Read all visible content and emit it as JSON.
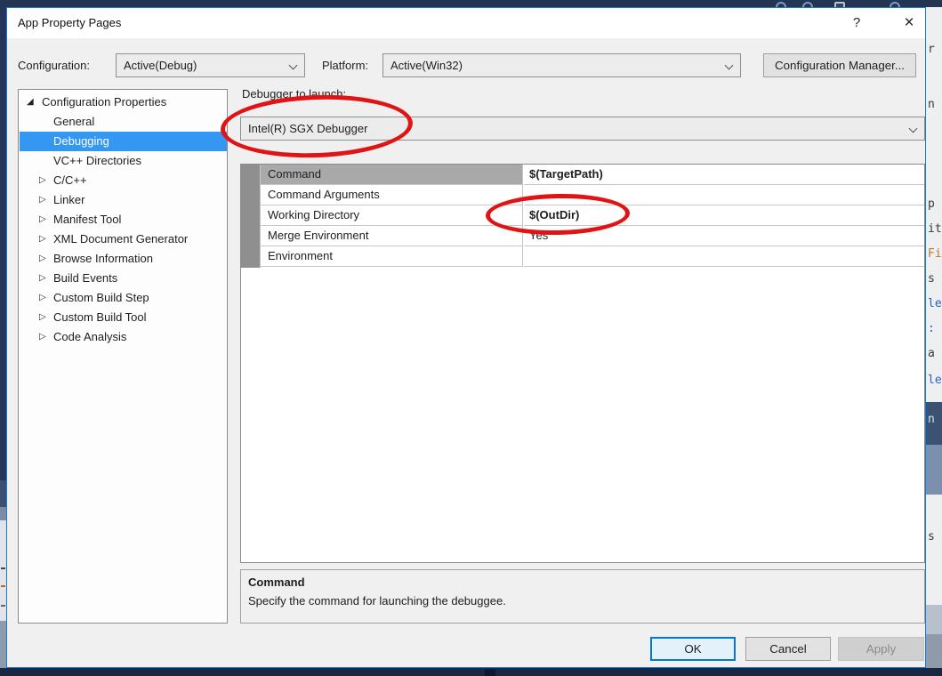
{
  "window": {
    "title": "App Property Pages",
    "help_label": "?",
    "close_label": "×"
  },
  "toolbar": {
    "configuration_label": "Configuration:",
    "configuration_value": "Active(Debug)",
    "platform_label": "Platform:",
    "platform_value": "Active(Win32)",
    "config_manager_label": "Configuration Manager..."
  },
  "tree": {
    "items": [
      {
        "label": "Configuration Properties",
        "level": 0,
        "state": "expanded",
        "selected": false
      },
      {
        "label": "General",
        "level": 1,
        "state": "leaf",
        "selected": false
      },
      {
        "label": "Debugging",
        "level": 1,
        "state": "leaf",
        "selected": true
      },
      {
        "label": "VC++ Directories",
        "level": 1,
        "state": "leaf",
        "selected": false
      },
      {
        "label": "C/C++",
        "level": 1,
        "state": "collapsed",
        "selected": false
      },
      {
        "label": "Linker",
        "level": 1,
        "state": "collapsed",
        "selected": false
      },
      {
        "label": "Manifest Tool",
        "level": 1,
        "state": "collapsed",
        "selected": false
      },
      {
        "label": "XML Document Generator",
        "level": 1,
        "state": "collapsed",
        "selected": false
      },
      {
        "label": "Browse Information",
        "level": 1,
        "state": "collapsed",
        "selected": false
      },
      {
        "label": "Build Events",
        "level": 1,
        "state": "collapsed",
        "selected": false
      },
      {
        "label": "Custom Build Step",
        "level": 1,
        "state": "collapsed",
        "selected": false
      },
      {
        "label": "Custom Build Tool",
        "level": 1,
        "state": "collapsed",
        "selected": false
      },
      {
        "label": "Code Analysis",
        "level": 1,
        "state": "collapsed",
        "selected": false
      }
    ]
  },
  "debugger": {
    "label": "Debugger to launch:",
    "value": "Intel(R) SGX Debugger"
  },
  "property_grid": {
    "rows": [
      {
        "name": "Command",
        "value": "$(TargetPath)",
        "bold": true,
        "selected": true
      },
      {
        "name": "Command Arguments",
        "value": "",
        "bold": false,
        "selected": false
      },
      {
        "name": "Working Directory",
        "value": "$(OutDir)",
        "bold": true,
        "selected": false
      },
      {
        "name": "Merge Environment",
        "value": "Yes",
        "bold": false,
        "selected": false
      },
      {
        "name": "Environment",
        "value": "",
        "bold": false,
        "selected": false
      }
    ]
  },
  "description": {
    "title": "Command",
    "text": "Specify the command for launching the debuggee."
  },
  "buttons": {
    "ok": "OK",
    "cancel": "Cancel",
    "apply": "Apply"
  },
  "annotations": [
    {
      "target": "debugger-dropdown",
      "shape": "ellipse",
      "color": "#e01414"
    },
    {
      "target": "working-directory-value",
      "shape": "ellipse",
      "color": "#e01414"
    }
  ],
  "colors": {
    "dialog_border": "#1579d6",
    "selection_blue": "#3498f3",
    "annotation_red": "#e01414",
    "background_dark": "#243453"
  },
  "background": {
    "right_fragments": [
      "r",
      "n",
      "p",
      "it",
      "Fi",
      "s",
      "le",
      ":",
      "a",
      "le",
      "n",
      "s"
    ]
  }
}
